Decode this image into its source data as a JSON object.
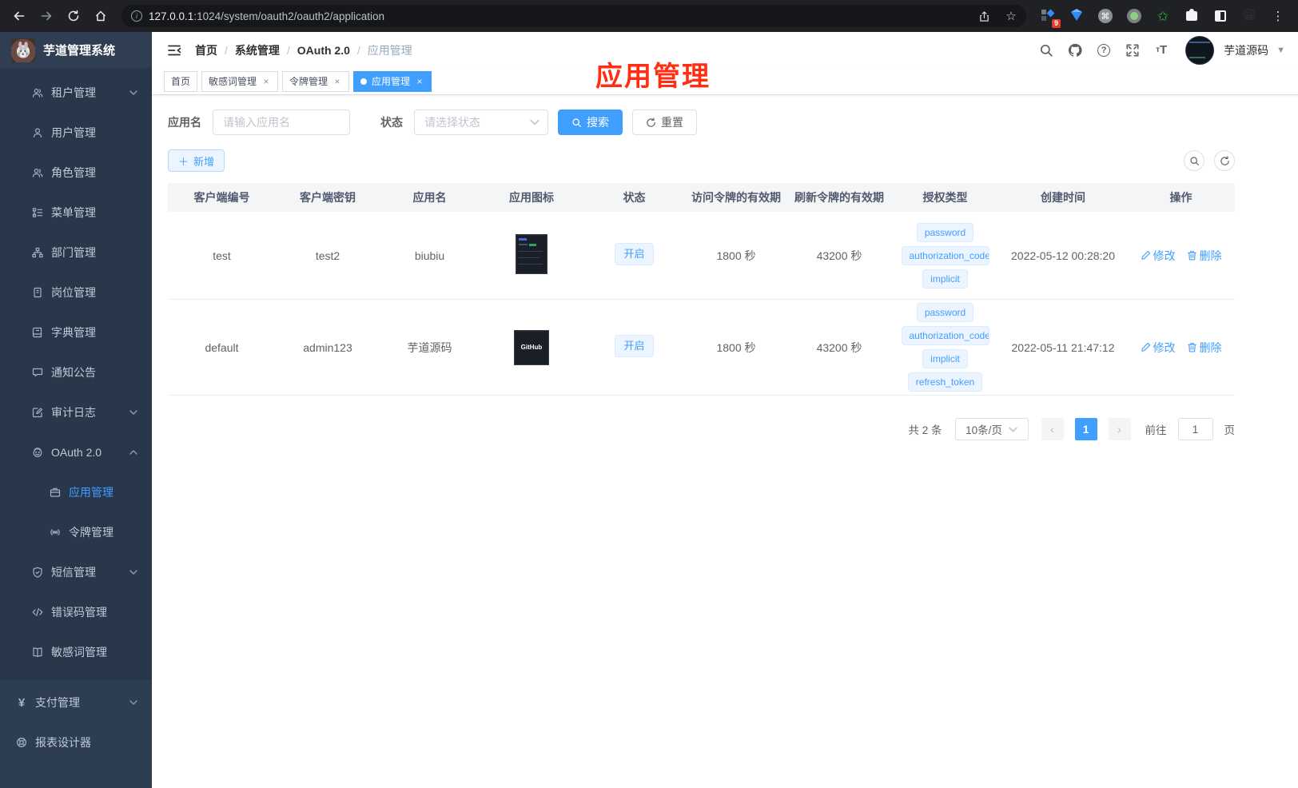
{
  "browser": {
    "url_host": "127.0.0.1",
    "url_rest": ":1024/system/oauth2/oauth2/application",
    "ext_badge": "9"
  },
  "glyphs": {
    "info": "i",
    "star": "☆",
    "dots": "⋮",
    "emoji": "😀",
    "cmd": "⌘",
    "green_star": "✩",
    "close": "×",
    "sep": "/",
    "question": "?",
    "font_small": "т",
    "font_big": "T",
    "caret": "▼",
    "prev": "‹",
    "next": "›",
    "plus": "＋",
    "yen": "¥"
  },
  "sidebar": {
    "logo_title": "芋道管理系统",
    "logo_emoji": "🐰",
    "items": [
      {
        "label": "租户管理"
      },
      {
        "label": "用户管理"
      },
      {
        "label": "角色管理"
      },
      {
        "label": "菜单管理"
      },
      {
        "label": "部门管理"
      },
      {
        "label": "岗位管理"
      },
      {
        "label": "字典管理"
      },
      {
        "label": "通知公告"
      },
      {
        "label": "审计日志"
      },
      {
        "label": "OAuth 2.0"
      },
      {
        "label": "应用管理"
      },
      {
        "label": "令牌管理"
      },
      {
        "label": "短信管理"
      },
      {
        "label": "错误码管理"
      },
      {
        "label": "敏感词管理"
      }
    ],
    "bottom": [
      {
        "label": "支付管理"
      },
      {
        "label": "报表设计器"
      }
    ]
  },
  "header": {
    "breadcrumb": [
      "首页",
      "系统管理",
      "OAuth 2.0",
      "应用管理"
    ],
    "username": "芋道源码"
  },
  "tabs": [
    {
      "label": "首页"
    },
    {
      "label": "敏感词管理"
    },
    {
      "label": "令牌管理"
    },
    {
      "label": "应用管理"
    }
  ],
  "annotation": {
    "text": "应用管理"
  },
  "filters": {
    "name_label": "应用名",
    "name_placeholder": "请输入应用名",
    "status_label": "状态",
    "status_placeholder": "请选择状态",
    "search_label": "搜索",
    "reset_label": "重置",
    "add_label": "新增"
  },
  "table": {
    "columns": [
      "客户端编号",
      "客户端密钥",
      "应用名",
      "应用图标",
      "状态",
      "访问令牌的有效期",
      "刷新令牌的有效期",
      "授权类型",
      "创建时间",
      "操作"
    ],
    "rows": [
      {
        "client_id": "test",
        "client_secret": "test2",
        "name": "biubiu",
        "status": "开启",
        "access_validity": "1800 秒",
        "refresh_validity": "43200 秒",
        "grant_types": [
          "password",
          "authorization_code",
          "implicit"
        ],
        "create_time": "2022-05-12 00:28:20"
      },
      {
        "client_id": "default",
        "client_secret": "admin123",
        "name": "芋道源码",
        "icon_label": "GitHub",
        "status": "开启",
        "access_validity": "1800 秒",
        "refresh_validity": "43200 秒",
        "grant_types": [
          "password",
          "authorization_code",
          "implicit",
          "refresh_token"
        ],
        "create_time": "2022-05-11 21:47:12"
      }
    ],
    "edit_label": "修改",
    "delete_label": "删除"
  },
  "pagination": {
    "total": "共 2 条",
    "size": "10条/页",
    "page": "1",
    "goto_label": "前往",
    "goto_value": "1",
    "page_unit": "页"
  },
  "colors": {
    "primary": "#409eff",
    "annotation": "#ff2d12",
    "sidebar_bg": "#2d3d52"
  }
}
